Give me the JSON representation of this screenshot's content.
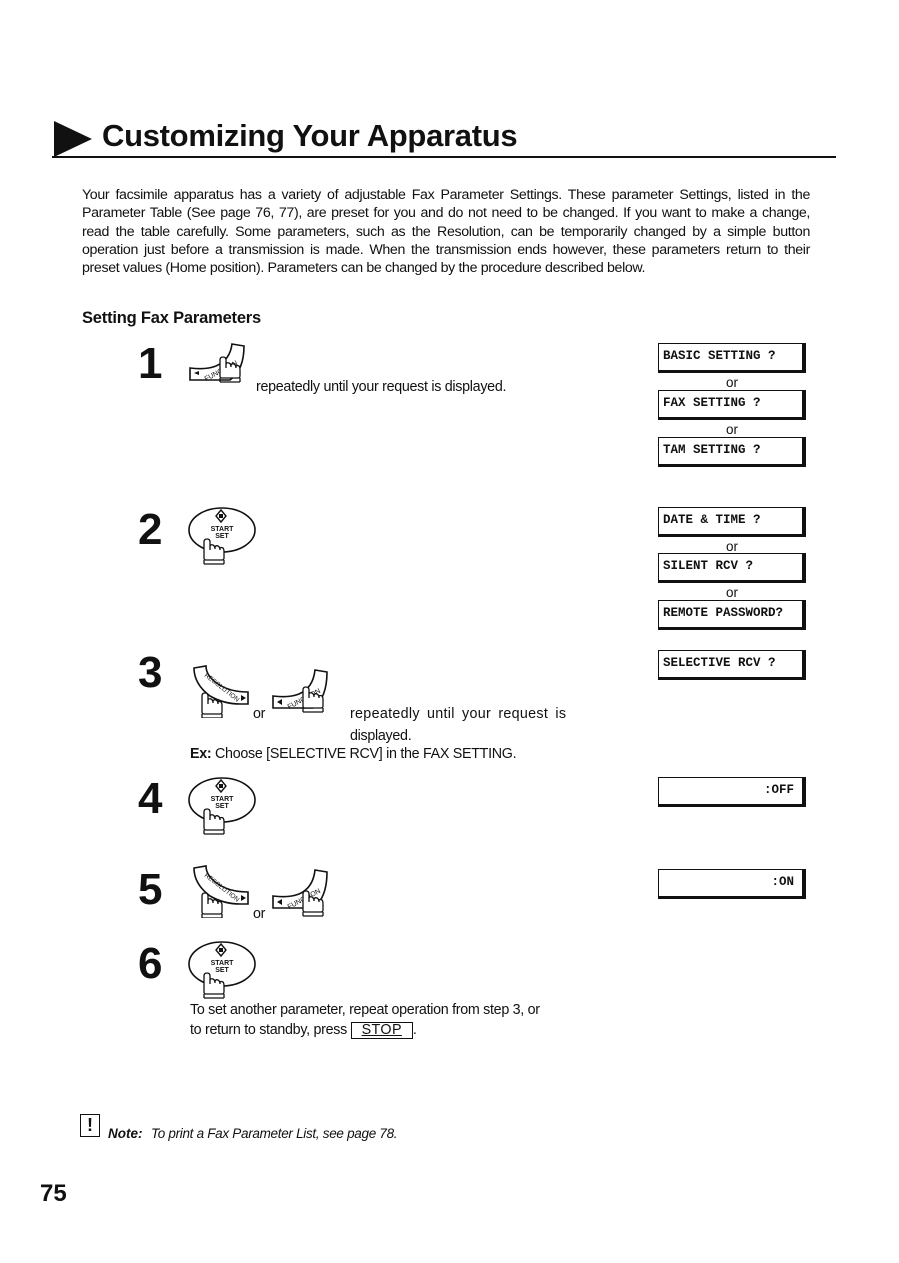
{
  "header": {
    "title": "Customizing Your Apparatus",
    "title_icon": "triangle-arrow-right"
  },
  "intro": "Your facsimile apparatus has a variety of adjustable Fax Parameter Settings. These parameter Settings, listed in the Parameter Table (See page 76, 77), are preset for you and do not need to be changed.  If you want to make a change, read the table carefully.  Some parameters, such as the Resolution, can be temporarily changed by a simple button operation just before a transmission is made.  When the transmission ends however, these parameters return to their preset values (Home position).  Parameters can be changed by the procedure described below.",
  "section": {
    "heading": "Setting Fax Parameters"
  },
  "keys": {
    "function": "FUNCTION",
    "resolution": "RESOLUTION",
    "start_top": "START",
    "start_bottom": "SET",
    "stop": "STOP"
  },
  "steps": [
    {
      "number": "1",
      "icons": [
        "function-key"
      ],
      "text": "repeatedly until your request is displayed.",
      "displays": [
        "BASIC SETTING ?",
        "FAX SETTING ?",
        "TAM SETTING ?"
      ]
    },
    {
      "number": "2",
      "icons": [
        "start-set-key"
      ],
      "displays": [
        "DATE & TIME ?",
        "SILENT RCV ?",
        "REMOTE PASSWORD?"
      ]
    },
    {
      "number": "3",
      "icons": [
        "resolution-key",
        "function-key"
      ],
      "connector": "or",
      "text_line1": "repeatedly  until  your  request  is",
      "text_line2": "displayed.",
      "example_label": "Ex:",
      "example_text": " Choose [SELECTIVE RCV] in the FAX SETTING.",
      "displays": [
        "SELECTIVE RCV ?"
      ]
    },
    {
      "number": "4",
      "icons": [
        "start-set-key"
      ],
      "displays": [
        ":OFF"
      ]
    },
    {
      "number": "5",
      "icons": [
        "resolution-key",
        "function-key"
      ],
      "connector": "or",
      "displays": [
        ":ON"
      ]
    },
    {
      "number": "6",
      "icons": [
        "start-set-key"
      ],
      "text_line1": "To set another parameter, repeat operation from step 3, or",
      "text_line2_prefix": "to return to standby, press ",
      "text_line2_suffix": "."
    }
  ],
  "display_connector": "or",
  "note": {
    "icon": "!",
    "label": "Note:",
    "text": "To print a Fax Parameter List, see page 78."
  },
  "page_number": "75"
}
